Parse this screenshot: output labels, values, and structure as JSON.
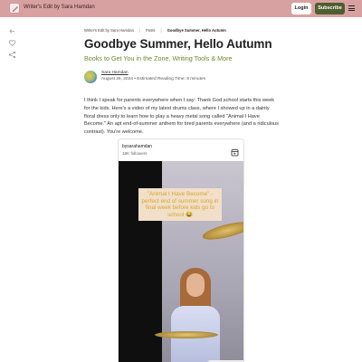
{
  "header": {
    "site_title": "Writer's Edit by Sara Hamdan",
    "login_label": "Login",
    "subscribe_label": "Subscribe"
  },
  "breadcrumb": {
    "items": [
      "Writer's Edit by Sara Hamdan",
      "Posts",
      "Goodbye Summer, Hello Autumn"
    ]
  },
  "post": {
    "title": "Goodbye Summer, Hello Autumn",
    "subtitle": "Books to Get You in the Zone, Writing Tools & More",
    "author": "Sara Hamdan",
    "meta": "August 26, 2024 • Estimated Reading Time: 8 minutes",
    "paragraph": "I think I speak for parents everywhere when I say: Thank God school starts this week for the kids. Here's a video of my latest drums class, where I showed up in a dainty floral dress only to learn how to play a heavy metal song called \"Animal I Have Become.\" An apt end-of-summer anthem for tired parents everywhere (and a ridiculous contrast). You're welcome."
  },
  "embed": {
    "username": "bysarahamdan",
    "followers": "18K followers",
    "caption": "\"Animal I Have Become\" - perfect end of summer song in final week before kids go to school 😂"
  },
  "colors": {
    "topbar": "#d8a1a1",
    "subscribe": "#4e5e2f",
    "subtitle": "#6b8a2f"
  }
}
